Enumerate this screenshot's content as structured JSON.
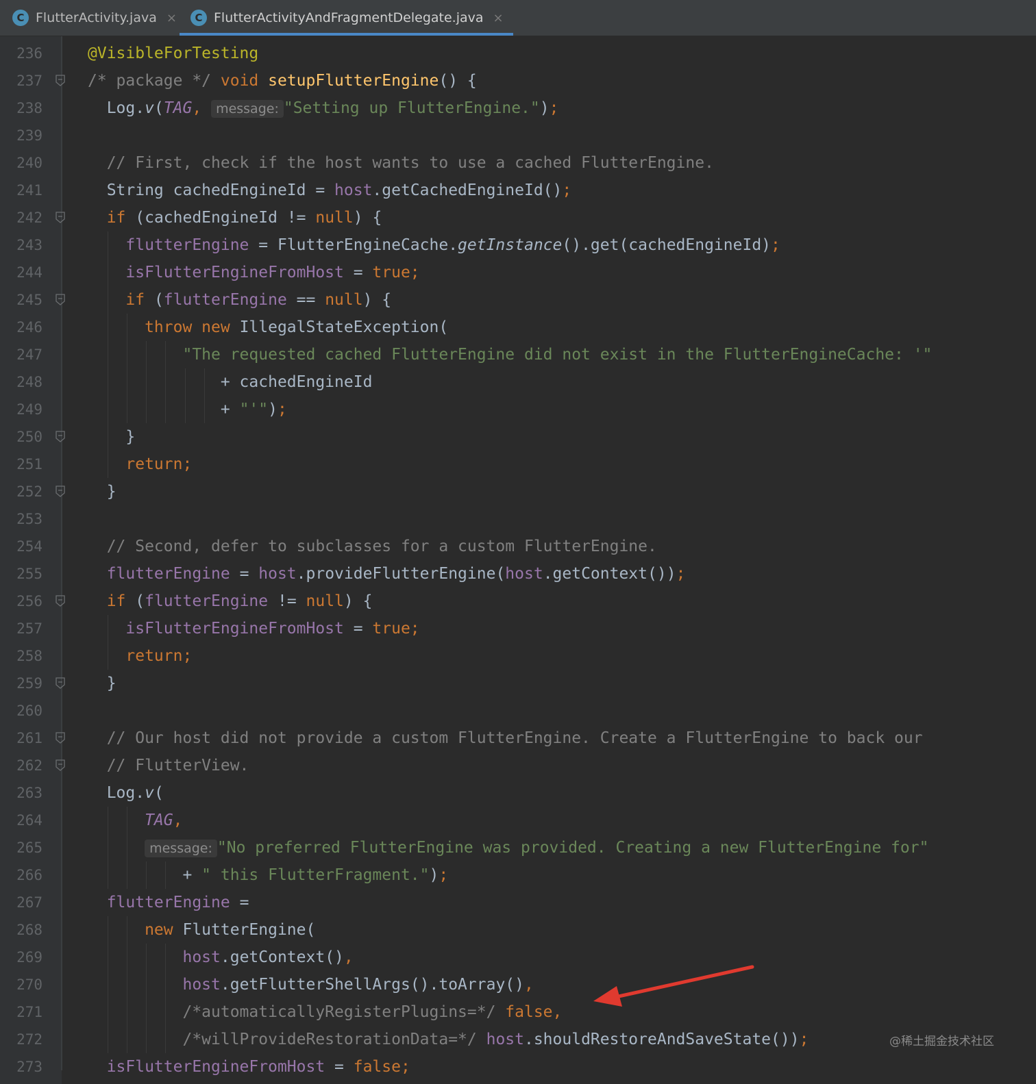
{
  "tabs": [
    {
      "icon": "C",
      "label": "FlutterActivity.java",
      "close": "×"
    },
    {
      "icon": "C",
      "label": "FlutterActivityAndFragmentDelegate.java",
      "close": "×"
    }
  ],
  "lines": [
    {
      "n": "236",
      "t": [
        [
          "a",
          "@VisibleForTesting"
        ]
      ]
    },
    {
      "n": "237",
      "t": [
        [
          "c",
          "/* package */ "
        ],
        [
          "k",
          "void "
        ],
        [
          "m",
          "setupFlutterEngine"
        ],
        [
          "",
          "() {"
        ]
      ]
    },
    {
      "n": "238",
      "t": [
        [
          "",
          "  Log."
        ],
        [
          "i",
          "v"
        ],
        [
          "",
          "("
        ],
        [
          "fi",
          "TAG"
        ],
        [
          "k",
          ", "
        ],
        [
          "h",
          "message:"
        ],
        [
          "s",
          "\"Setting up FlutterEngine.\""
        ],
        [
          "",
          ")"
        ],
        [
          "k",
          ";"
        ]
      ]
    },
    {
      "n": "239",
      "t": []
    },
    {
      "n": "240",
      "t": [
        [
          "c",
          "  // First, check if the host wants to use a cached FlutterEngine."
        ]
      ]
    },
    {
      "n": "241",
      "t": [
        [
          "",
          "  String cachedEngineId = "
        ],
        [
          "f",
          "host"
        ],
        [
          "",
          ".getCachedEngineId()"
        ],
        [
          "k",
          ";"
        ]
      ]
    },
    {
      "n": "242",
      "t": [
        [
          "k",
          "  if "
        ],
        [
          "",
          "(cachedEngineId != "
        ],
        [
          "k",
          "null"
        ],
        [
          "",
          ") {"
        ]
      ]
    },
    {
      "n": "243",
      "t": [
        [
          "f",
          "    flutterEngine"
        ],
        [
          "",
          " = FlutterEngineCache."
        ],
        [
          "i",
          "getInstance"
        ],
        [
          "",
          "().get(cachedEngineId)"
        ],
        [
          "k",
          ";"
        ]
      ]
    },
    {
      "n": "244",
      "t": [
        [
          "f",
          "    isFlutterEngineFromHost"
        ],
        [
          "",
          " = "
        ],
        [
          "k",
          "true;"
        ]
      ]
    },
    {
      "n": "245",
      "t": [
        [
          "k",
          "    if "
        ],
        [
          "",
          "("
        ],
        [
          "f",
          "flutterEngine"
        ],
        [
          "",
          " == "
        ],
        [
          "k",
          "null"
        ],
        [
          "",
          ") {"
        ]
      ]
    },
    {
      "n": "246",
      "t": [
        [
          "k",
          "      throw new "
        ],
        [
          "",
          "IllegalStateException("
        ]
      ]
    },
    {
      "n": "247",
      "t": [
        [
          "s",
          "          \"The requested cached FlutterEngine did not exist in the FlutterEngineCache: '\""
        ]
      ]
    },
    {
      "n": "248",
      "t": [
        [
          "",
          "              + cachedEngineId"
        ]
      ]
    },
    {
      "n": "249",
      "t": [
        [
          "",
          "              + "
        ],
        [
          "s",
          "\"'\""
        ],
        [
          "",
          ")"
        ],
        [
          "k",
          ";"
        ]
      ]
    },
    {
      "n": "250",
      "t": [
        [
          "",
          "    }"
        ]
      ]
    },
    {
      "n": "251",
      "t": [
        [
          "k",
          "    return;"
        ]
      ]
    },
    {
      "n": "252",
      "t": [
        [
          "",
          "  }"
        ]
      ]
    },
    {
      "n": "253",
      "t": []
    },
    {
      "n": "254",
      "t": [
        [
          "c",
          "  // Second, defer to subclasses for a custom FlutterEngine."
        ]
      ]
    },
    {
      "n": "255",
      "t": [
        [
          "f",
          "  flutterEngine"
        ],
        [
          "",
          " = "
        ],
        [
          "f",
          "host"
        ],
        [
          "",
          ".provideFlutterEngine("
        ],
        [
          "f",
          "host"
        ],
        [
          "",
          ".getContext())"
        ],
        [
          "k",
          ";"
        ]
      ]
    },
    {
      "n": "256",
      "t": [
        [
          "k",
          "  if "
        ],
        [
          "",
          "("
        ],
        [
          "f",
          "flutterEngine"
        ],
        [
          "",
          " != "
        ],
        [
          "k",
          "null"
        ],
        [
          "",
          ") {"
        ]
      ]
    },
    {
      "n": "257",
      "t": [
        [
          "f",
          "    isFlutterEngineFromHost"
        ],
        [
          "",
          " = "
        ],
        [
          "k",
          "true;"
        ]
      ]
    },
    {
      "n": "258",
      "t": [
        [
          "k",
          "    return;"
        ]
      ]
    },
    {
      "n": "259",
      "t": [
        [
          "",
          "  }"
        ]
      ]
    },
    {
      "n": "260",
      "t": []
    },
    {
      "n": "261",
      "t": [
        [
          "c",
          "  // Our host did not provide a custom FlutterEngine. Create a FlutterEngine to back our"
        ]
      ]
    },
    {
      "n": "262",
      "t": [
        [
          "c",
          "  // FlutterView."
        ]
      ]
    },
    {
      "n": "263",
      "t": [
        [
          "",
          "  Log."
        ],
        [
          "i",
          "v"
        ],
        [
          "",
          "("
        ]
      ]
    },
    {
      "n": "264",
      "t": [
        [
          "fi",
          "      TAG"
        ],
        [
          "k",
          ","
        ]
      ]
    },
    {
      "n": "265",
      "t": [
        [
          "",
          "      "
        ],
        [
          "h",
          "message:"
        ],
        [
          "s",
          "\"No preferred FlutterEngine was provided. Creating a new FlutterEngine for\""
        ]
      ]
    },
    {
      "n": "266",
      "t": [
        [
          "",
          "          + "
        ],
        [
          "s",
          "\" this FlutterFragment.\""
        ],
        [
          "",
          ")"
        ],
        [
          "k",
          ";"
        ]
      ]
    },
    {
      "n": "267",
      "t": [
        [
          "f",
          "  flutterEngine"
        ],
        [
          "",
          " ="
        ]
      ]
    },
    {
      "n": "268",
      "t": [
        [
          "k",
          "      new "
        ],
        [
          "",
          "FlutterEngine("
        ]
      ]
    },
    {
      "n": "269",
      "t": [
        [
          "f",
          "          host"
        ],
        [
          "",
          ".getContext()"
        ],
        [
          "k",
          ","
        ]
      ]
    },
    {
      "n": "270",
      "t": [
        [
          "f",
          "          host"
        ],
        [
          "",
          ".getFlutterShellArgs().toArray()"
        ],
        [
          "k",
          ","
        ]
      ]
    },
    {
      "n": "271",
      "t": [
        [
          "c",
          "          /*automaticallyRegisterPlugins=*/ "
        ],
        [
          "k",
          "false,"
        ]
      ]
    },
    {
      "n": "272",
      "t": [
        [
          "c",
          "          /*willProvideRestorationData=*/ "
        ],
        [
          "f",
          "host"
        ],
        [
          "",
          ".shouldRestoreAndSaveState())"
        ],
        [
          "k",
          ";"
        ]
      ]
    },
    {
      "n": "273",
      "t": [
        [
          "f",
          "  isFlutterEngineFromHost"
        ],
        [
          "",
          " = "
        ],
        [
          "k",
          "false;"
        ]
      ]
    }
  ],
  "folds": [
    "237",
    "242",
    "245",
    "250",
    "252",
    "256",
    "259",
    "261",
    "262"
  ],
  "watermark": "@稀土掘金技术社区",
  "colors": {
    "background": "#2b2b2b",
    "keyword": "#cc7832",
    "string": "#6a8759",
    "comment": "#808080",
    "field": "#9876aa",
    "method": "#ffc66d",
    "annotation": "#bbb529",
    "arrow": "#e03a2f"
  }
}
